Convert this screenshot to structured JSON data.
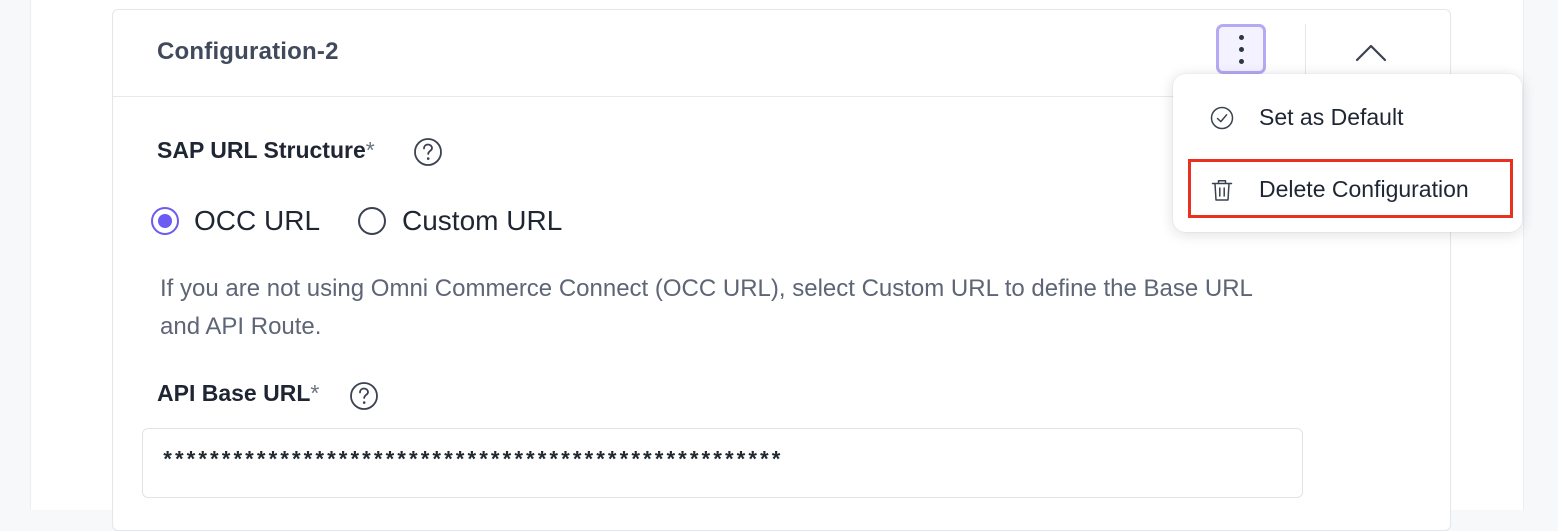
{
  "config_card": {
    "title": "Configuration-2",
    "more_actions_icon": "kebab-menu-icon",
    "collapse_icon": "chevron-up-icon"
  },
  "url_structure": {
    "label": "SAP URL Structure",
    "required_mark": "*",
    "help_icon": "question-circle-icon",
    "options": [
      {
        "label": "OCC URL",
        "selected": true
      },
      {
        "label": "Custom URL",
        "selected": false
      }
    ],
    "help_text": "If you are not using Omni Commerce Connect (OCC URL), select Custom URL to define the Base URL and API Route."
  },
  "api_base_url": {
    "label": "API Base URL",
    "required_mark": "*",
    "help_icon": "question-circle-icon",
    "value": "*****************************************************"
  },
  "dropdown_menu": {
    "items": [
      {
        "label": "Set as Default",
        "icon": "check-circle-icon"
      },
      {
        "label": "Delete Configuration",
        "icon": "trash-icon",
        "highlighted": true
      }
    ]
  },
  "colors": {
    "accent": "#6b5bf2",
    "highlight": "#e8321f",
    "text_primary": "#1f2633",
    "text_secondary": "#5d6576"
  }
}
